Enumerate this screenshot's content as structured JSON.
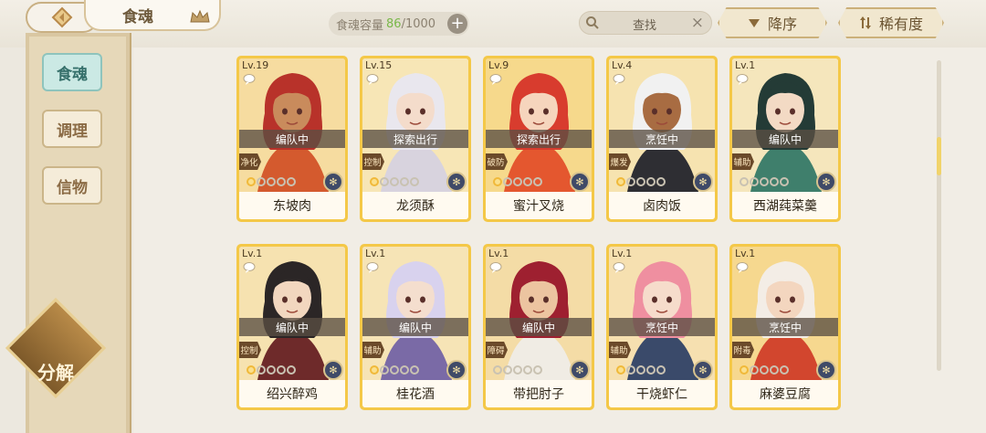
{
  "header": {
    "title": "食魂",
    "capacity_label": "食魂容量",
    "capacity_current": "86",
    "capacity_max": "/1000",
    "plus_label": "+",
    "search_label": "查找",
    "clear_label": "×",
    "sort_desc_label": "降序",
    "sort_rarity_label": "稀有度"
  },
  "sidebar": {
    "tabs": [
      {
        "label": "食魂",
        "active": true
      },
      {
        "label": "调理",
        "active": false
      },
      {
        "label": "信物",
        "active": false
      }
    ],
    "decompose_label": "分解"
  },
  "cards": [
    {
      "level": "Lv.19",
      "status": "编队中",
      "role": "净化",
      "name": "东坡肉",
      "stars": 1,
      "hair": "#b8322a",
      "bg": "#f6dca0",
      "skin": "#c98b5c",
      "outfit": "#d45a2e"
    },
    {
      "level": "Lv.15",
      "status": "探索出行",
      "role": "控制",
      "name": "龙须酥",
      "stars": 1,
      "hair": "#e9e7ee",
      "bg": "#f7e6b6",
      "skin": "#f4dccb",
      "outfit": "#d8d3de"
    },
    {
      "level": "Lv.9",
      "status": "探索出行",
      "role": "破防",
      "name": "蜜汁叉烧",
      "stars": 1,
      "hair": "#d83c2e",
      "bg": "#f6d98c",
      "skin": "#f6d5bd",
      "outfit": "#e4572f"
    },
    {
      "level": "Lv.4",
      "status": "烹饪中",
      "role": "爆发",
      "name": "卤肉饭",
      "stars": 1,
      "hair": "#f1f1f1",
      "bg": "#f6e3b0",
      "skin": "#a86c42",
      "outfit": "#2e2e33"
    },
    {
      "level": "Lv.1",
      "status": "编队中",
      "role": "辅助",
      "name": "西湖莼菜羹",
      "stars": 0,
      "hair": "#243b36",
      "bg": "#f5e6bc",
      "skin": "#f3dac4",
      "outfit": "#3f7f6c"
    },
    {
      "level": "Lv.1",
      "status": "编队中",
      "role": "控制",
      "name": "绍兴醉鸡",
      "stars": 1,
      "hair": "#2b2626",
      "bg": "#f6e2b0",
      "skin": "#f2d7bf",
      "outfit": "#6e2a2a"
    },
    {
      "level": "Lv.1",
      "status": "编队中",
      "role": "辅助",
      "name": "桂花酒",
      "stars": 1,
      "hair": "#d8d2ee",
      "bg": "#f6e4b6",
      "skin": "#f4dece",
      "outfit": "#7a6aa6"
    },
    {
      "level": "Lv.1",
      "status": "编队中",
      "role": "障碍",
      "name": "带把肘子",
      "stars": 0,
      "hair": "#9e2030",
      "bg": "#f4dca6",
      "skin": "#ecc4a0",
      "outfit": "#f0ece4"
    },
    {
      "level": "Lv.1",
      "status": "烹饪中",
      "role": "辅助",
      "name": "干烧虾仁",
      "stars": 1,
      "hair": "#ef8fa0",
      "bg": "#f6e0b0",
      "skin": "#f6dccb",
      "outfit": "#3a4a6a"
    },
    {
      "level": "Lv.1",
      "status": "烹饪中",
      "role": "附毒",
      "name": "麻婆豆腐",
      "stars": 1,
      "hair": "#f3ede6",
      "bg": "#f6d88f",
      "skin": "#f3d6bf",
      "outfit": "#d2462e"
    }
  ]
}
